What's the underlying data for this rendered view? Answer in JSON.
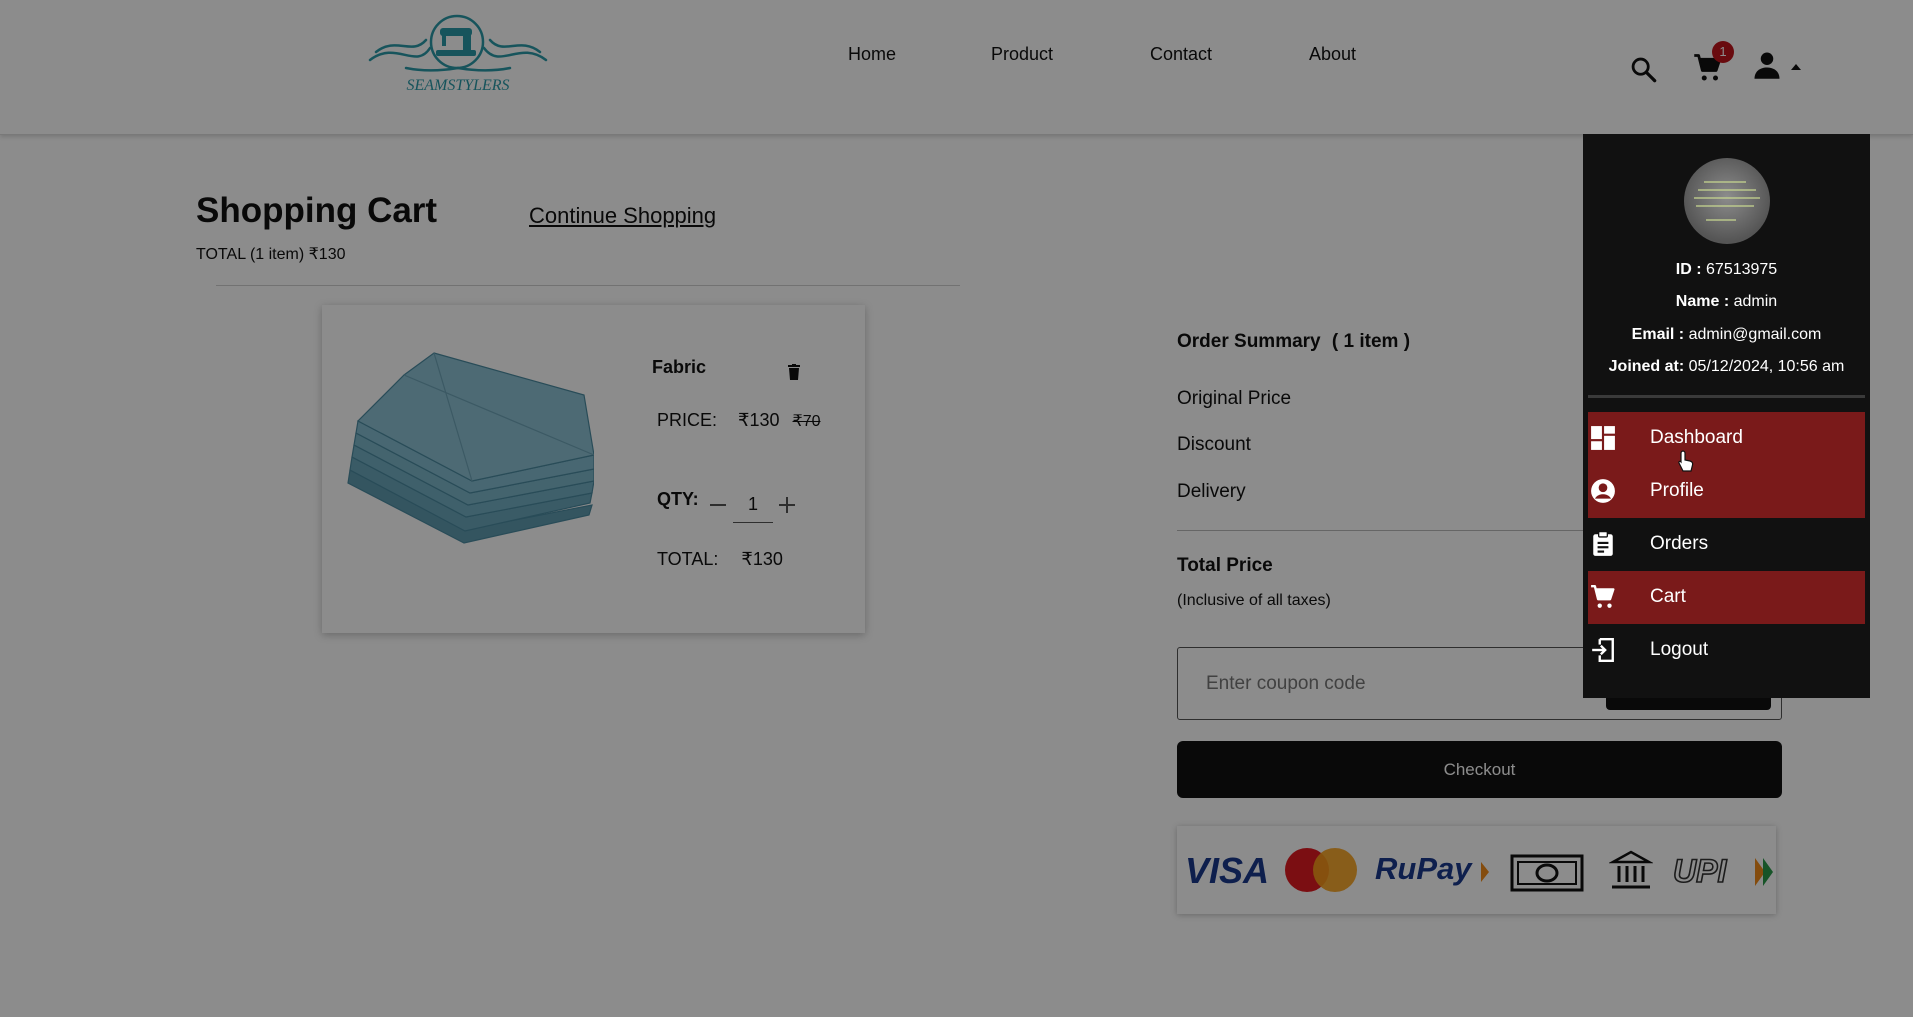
{
  "brand": {
    "logo_text": "SEAMSTYLERS"
  },
  "nav": {
    "items": [
      "Home",
      "Product",
      "Contact",
      "About"
    ]
  },
  "header": {
    "cart_badge": "1",
    "icons": [
      "search-icon",
      "cart-icon",
      "user-icon",
      "caret-up-icon"
    ]
  },
  "cart": {
    "title": "Shopping Cart",
    "continue_label": "Continue Shopping",
    "total_line": "TOTAL (1 item) ₹130",
    "item": {
      "name": "Fabric",
      "price_label": "PRICE:",
      "price": "₹130",
      "original_price": "₹70",
      "qty_label": "QTY:",
      "qty": "1",
      "total_label": "TOTAL:",
      "total": "₹130"
    }
  },
  "summary": {
    "title": "Order Summary",
    "count": "( 1 item )",
    "rows": [
      "Original Price",
      "Discount",
      "Delivery"
    ],
    "total_label": "Total Price",
    "inclusive_note": "(Inclusive of all taxes)",
    "coupon_placeholder": "Enter coupon code",
    "checkout_label": "Checkout",
    "payment_methods": [
      "VISA",
      "Mastercard",
      "RuPay",
      "Cash",
      "Bank",
      "UPI"
    ],
    "payment_texts": {
      "visa": "VISA",
      "rupay": "RuPay",
      "upi": "UPI"
    }
  },
  "profile_menu": {
    "id_label": "ID :",
    "id_value": "67513975",
    "name_label": "Name :",
    "name_value": "admin",
    "email_label": "Email :",
    "email_value": "admin@gmail.com",
    "joined_label": "Joined at:",
    "joined_value": "05/12/2024, 10:56 am",
    "items": [
      "Dashboard",
      "Profile",
      "Orders",
      "Cart",
      "Logout"
    ],
    "active_items": [
      "Dashboard",
      "Profile",
      "Cart"
    ]
  },
  "colors": {
    "accent": "#7a1a1a",
    "badge": "#c0141c",
    "logo": "#2a9aa8",
    "dropdown_bg": "#111111"
  }
}
